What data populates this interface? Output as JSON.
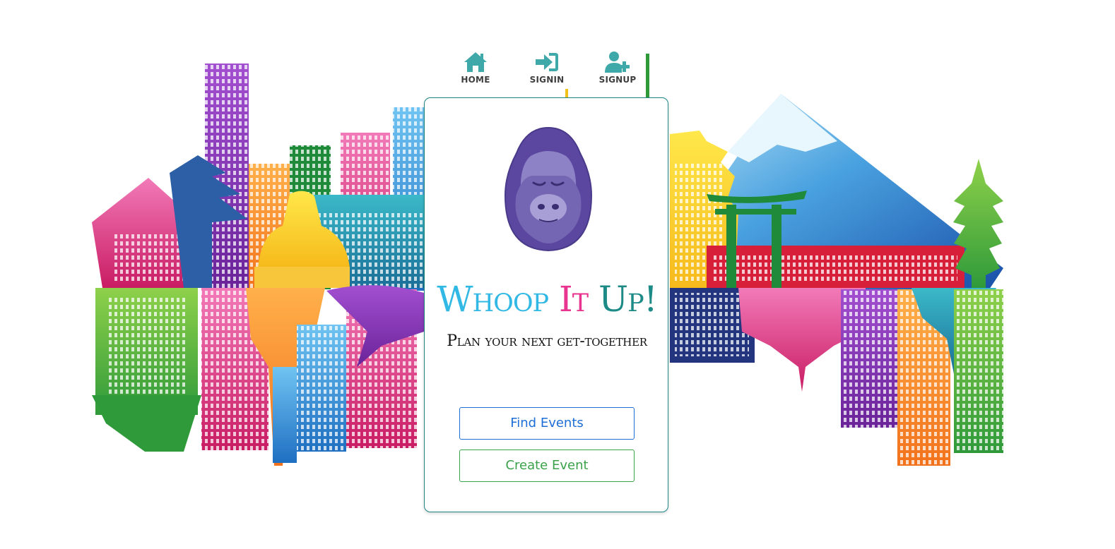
{
  "nav": {
    "items": [
      {
        "label": "HOME",
        "icon": "home-icon"
      },
      {
        "label": "SIGNIN",
        "icon": "sign-in-icon"
      },
      {
        "label": "SIGNUP",
        "icon": "add-user-icon"
      }
    ],
    "icon_color": "#3fa8a8"
  },
  "hero": {
    "title_word_1": "Whoop",
    "title_word_2": "It",
    "title_word_3": "Up!",
    "tagline": "Plan your next get-together",
    "mascot": "gorilla-icon"
  },
  "actions": {
    "find_label": "Find Events",
    "create_label": "Create Event"
  },
  "colors": {
    "card_border": "#1f8585",
    "title_blue": "#32b8e4",
    "title_pink": "#e8338f",
    "title_teal": "#1c8a86",
    "find_button": "#1d6ed6",
    "create_button": "#3aa24a"
  }
}
